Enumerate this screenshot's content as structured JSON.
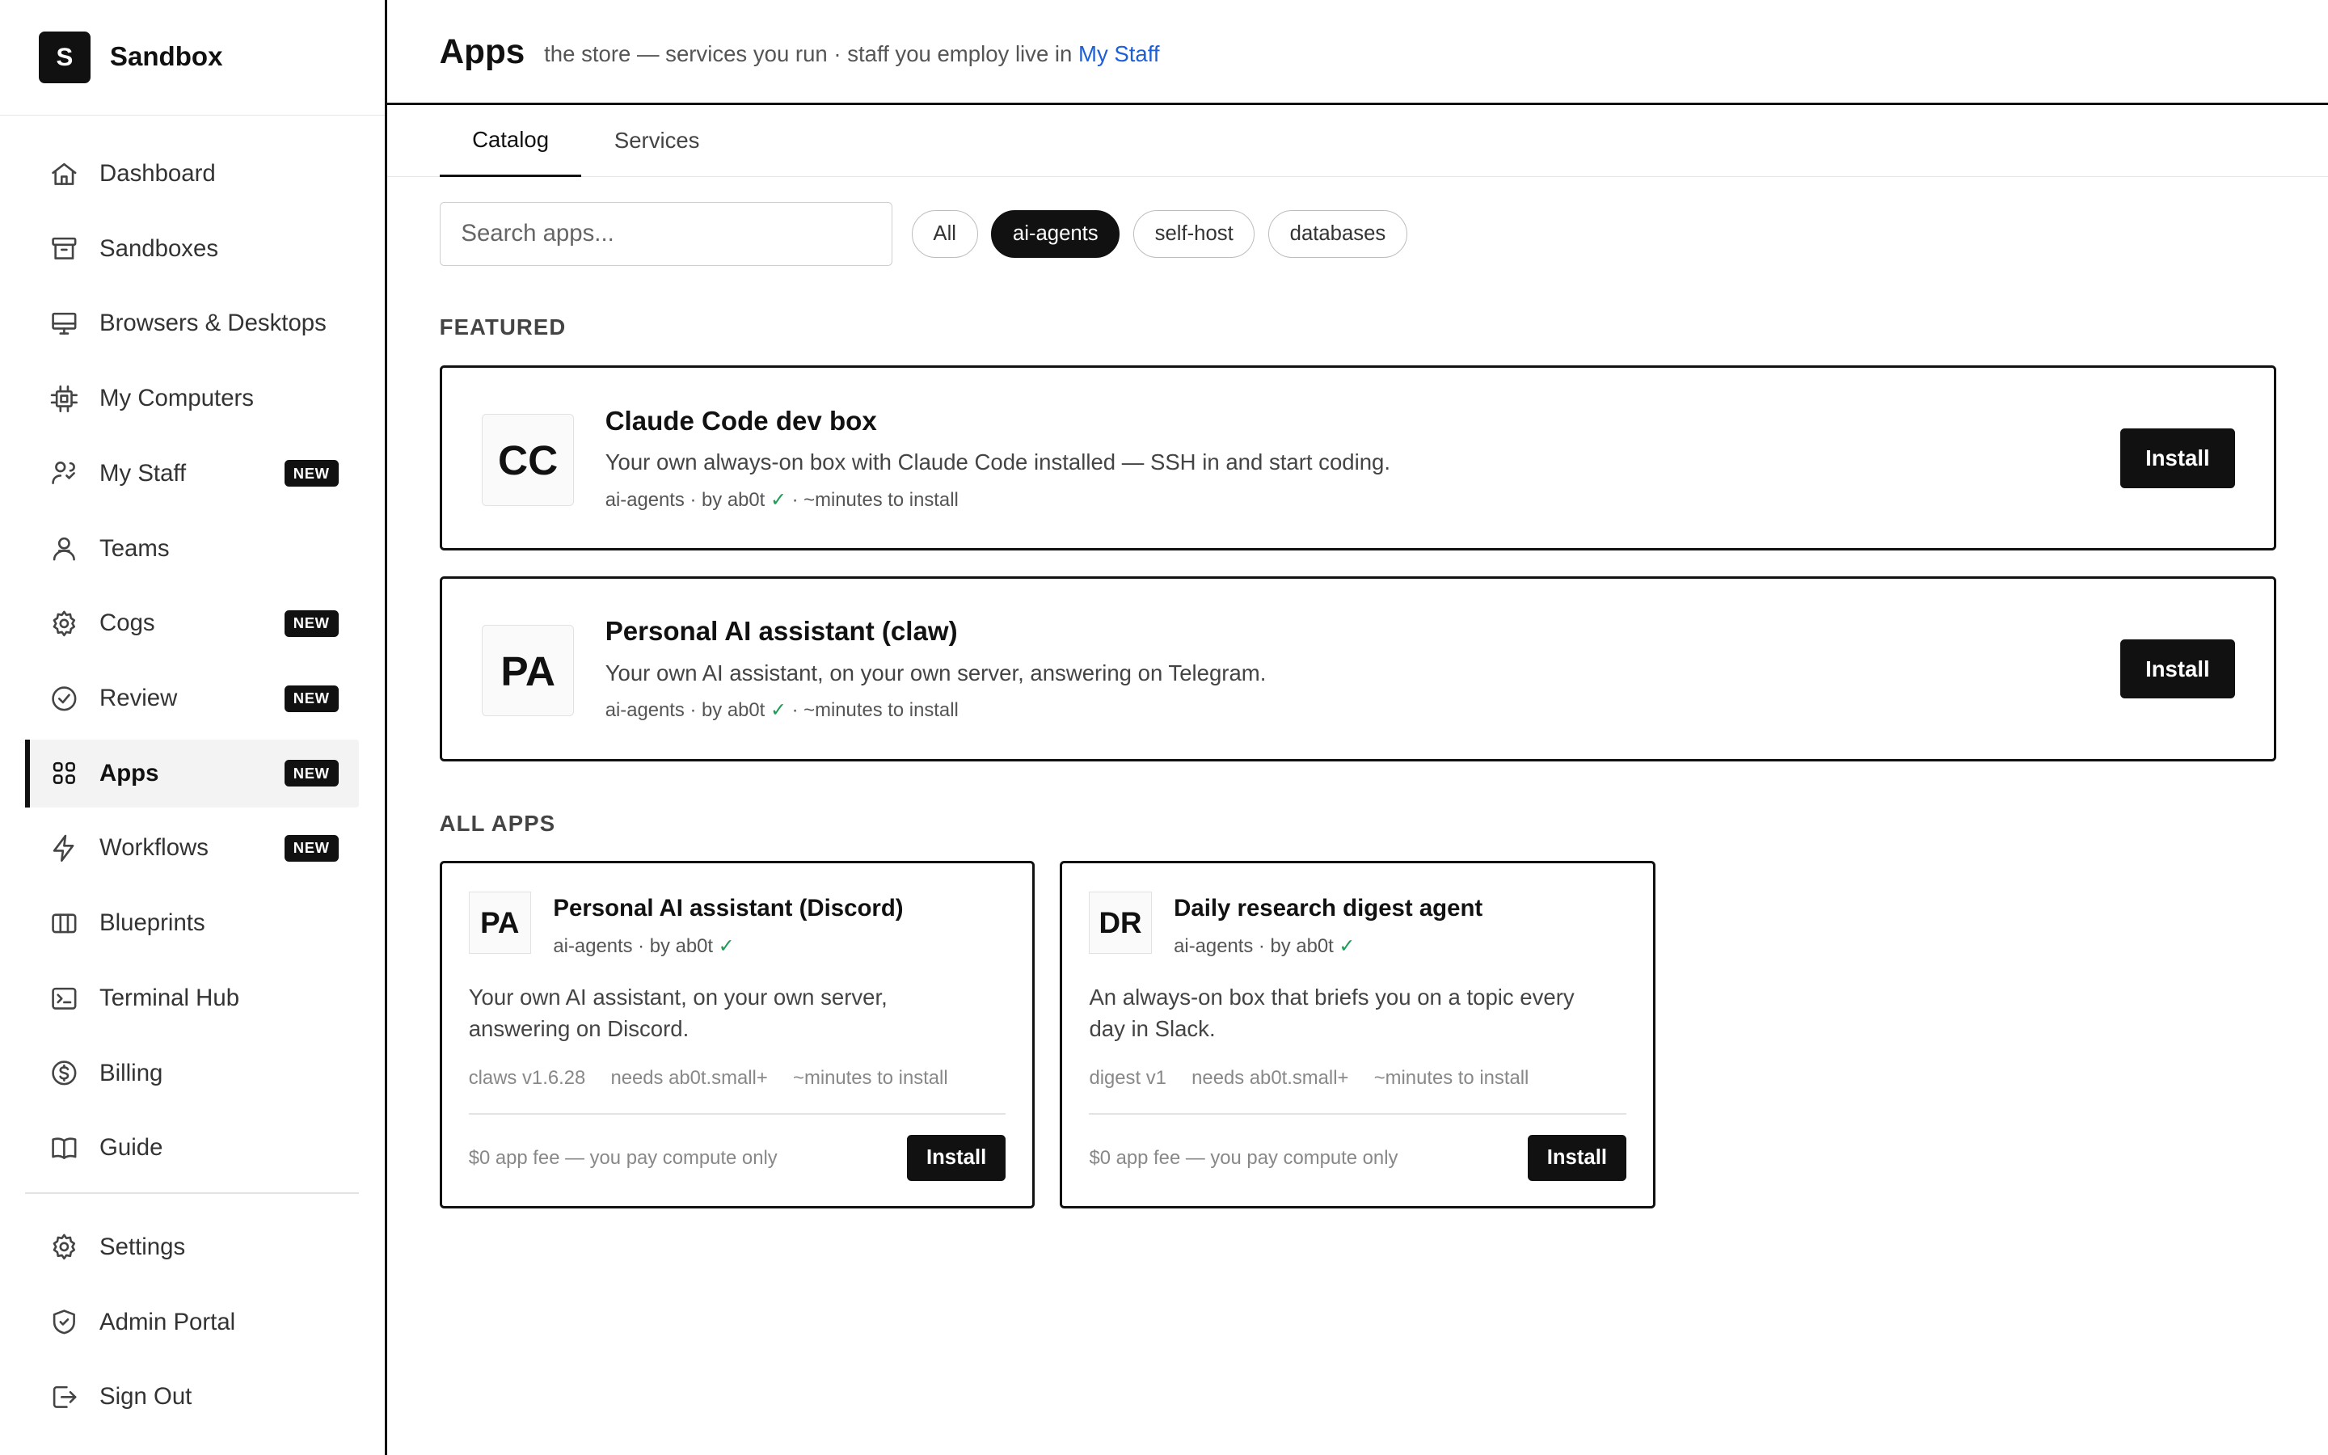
{
  "brand": {
    "logo_letter": "S",
    "name": "Sandbox"
  },
  "sidebar": {
    "items": [
      {
        "label": "Dashboard",
        "icon": "home-icon"
      },
      {
        "label": "Sandboxes",
        "icon": "archive-icon"
      },
      {
        "label": "Browsers & Desktops",
        "icon": "monitor-icon"
      },
      {
        "label": "My Computers",
        "icon": "cpu-icon"
      },
      {
        "label": "My Staff",
        "icon": "staff-icon",
        "badge": "NEW"
      },
      {
        "label": "Teams",
        "icon": "users-icon"
      },
      {
        "label": "Cogs",
        "icon": "gear-icon",
        "badge": "NEW"
      },
      {
        "label": "Review",
        "icon": "check-circle-icon",
        "badge": "NEW"
      },
      {
        "label": "Apps",
        "icon": "grid-icon",
        "badge": "NEW",
        "active": true
      },
      {
        "label": "Workflows",
        "icon": "bolt-icon",
        "badge": "NEW"
      },
      {
        "label": "Blueprints",
        "icon": "columns-icon"
      },
      {
        "label": "Terminal Hub",
        "icon": "terminal-icon"
      },
      {
        "label": "Billing",
        "icon": "dollar-icon"
      },
      {
        "label": "Guide",
        "icon": "book-icon"
      }
    ],
    "bottom_items": [
      {
        "label": "Settings",
        "icon": "gear-icon"
      },
      {
        "label": "Admin Portal",
        "icon": "shield-icon"
      },
      {
        "label": "Sign Out",
        "icon": "sign-out-icon"
      }
    ]
  },
  "header": {
    "title": "Apps",
    "subtitle": "the store — services you run · staff you employ live in",
    "link": "My Staff"
  },
  "tabs": [
    {
      "label": "Catalog",
      "active": true
    },
    {
      "label": "Services",
      "active": false
    }
  ],
  "search": {
    "placeholder": "Search apps...",
    "value": ""
  },
  "chips": [
    {
      "label": "All",
      "active": false
    },
    {
      "label": "ai-agents",
      "active": true
    },
    {
      "label": "self-host",
      "active": false
    },
    {
      "label": "databases",
      "active": false
    }
  ],
  "featured": {
    "heading": "FEATURED",
    "items": [
      {
        "mono": "CC",
        "title": "Claude Code dev box",
        "desc": "Your own always-on box with Claude Code installed — SSH in and start coding.",
        "meta_prefix": "ai-agents · by ab0t",
        "meta_suffix": "· ~minutes to install",
        "button": "Install"
      },
      {
        "mono": "PA",
        "title": "Personal AI assistant (claw)",
        "desc": "Your own AI assistant, on your own server, answering on Telegram.",
        "meta_prefix": "ai-agents · by ab0t",
        "meta_suffix": "· ~minutes to install",
        "button": "Install"
      }
    ]
  },
  "all_apps": {
    "heading": "ALL APPS",
    "items": [
      {
        "mono": "PA",
        "title": "Personal AI assistant (Discord)",
        "meta": "ai-agents · by ab0t",
        "desc": "Your own AI assistant, on your own server, answering on Discord.",
        "specs": [
          "claws v1.6.28",
          "needs ab0t.small+",
          "~minutes to install"
        ],
        "fee": "$0 app fee — you pay compute only",
        "button": "Install"
      },
      {
        "mono": "DR",
        "title": "Daily research digest agent",
        "meta": "ai-agents · by ab0t",
        "desc": "An always-on box that briefs you on a topic every day in Slack.",
        "specs": [
          "digest v1",
          "needs ab0t.small+",
          "~minutes to install"
        ],
        "fee": "$0 app fee — you pay compute only",
        "button": "Install"
      }
    ]
  },
  "check_mark": "✓"
}
